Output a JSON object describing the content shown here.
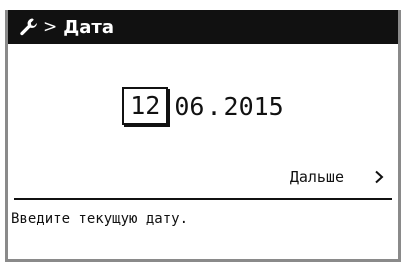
{
  "header": {
    "icon": "wrench-icon",
    "separator": ">",
    "title": "Дата"
  },
  "date": {
    "day": "12",
    "month": "06",
    "year": "2015",
    "separator": "."
  },
  "navigation": {
    "next_label": "Дальше",
    "next_icon": "chevron-right-icon"
  },
  "hint": "Введите текущую дату.",
  "colors": {
    "titlebar_bg": "#111111",
    "titlebar_fg": "#ffffff",
    "text": "#111111",
    "background": "#ffffff"
  }
}
